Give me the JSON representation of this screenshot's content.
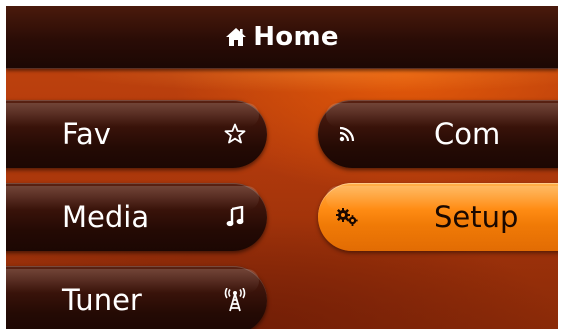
{
  "title": "Home",
  "buttons": {
    "fav": "Fav",
    "com": "Com",
    "media": "Media",
    "setup": "Setup",
    "tuner": "Tuner"
  },
  "colors": {
    "background": "#b23a0c",
    "button": "#2a0c06",
    "active_button": "#ff8c14",
    "text": "#ffffff",
    "active_text": "#1a0800"
  },
  "icons": {
    "title": "home-icon",
    "fav": "star-icon",
    "com": "rss-signal-icon",
    "media": "music-note-icon",
    "setup": "gears-icon",
    "tuner": "antenna-tower-icon"
  },
  "selected": "setup"
}
